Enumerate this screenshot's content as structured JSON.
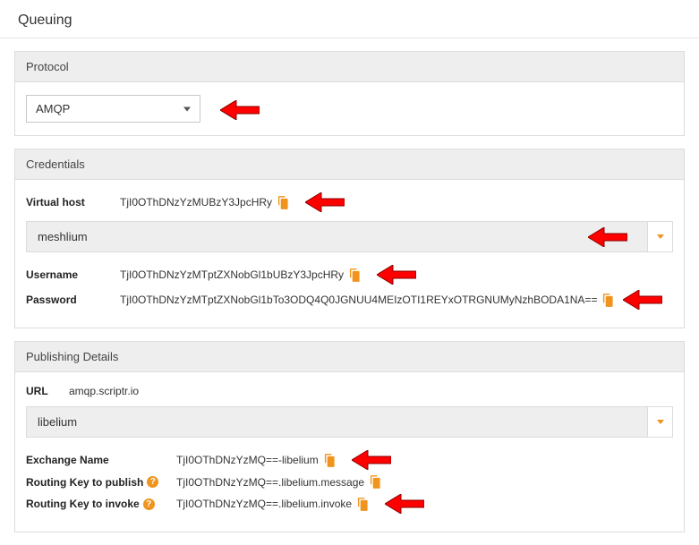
{
  "title": "Queuing",
  "protocol": {
    "header": "Protocol",
    "selected": "AMQP"
  },
  "credentials": {
    "header": "Credentials",
    "virtualHost": {
      "label": "Virtual host",
      "value": "TjI0OThDNzYzMUBzY3JpcHRy"
    },
    "dropdown": "meshlium",
    "username": {
      "label": "Username",
      "value": "TjI0OThDNzYzMTptZXNobGl1bUBzY3JpcHRy"
    },
    "password": {
      "label": "Password",
      "value": "TjI0OThDNzYzMTptZXNobGl1bTo3ODQ4Q0JGNUU4MEIzOTI1REYxOTRGNUMyNzhBODA1NA=="
    }
  },
  "publishing": {
    "header": "Publishing Details",
    "url": {
      "label": "URL",
      "value": "amqp.scriptr.io"
    },
    "dropdown": "libelium",
    "exchangeName": {
      "label": "Exchange Name",
      "value": "TjI0OThDNzYzMQ==-libelium"
    },
    "routingKeyPublish": {
      "label": "Routing Key to publish",
      "value": "TjI0OThDNzYzMQ==.libelium.message"
    },
    "routingKeyInvoke": {
      "label": "Routing Key to invoke",
      "value": "TjI0OThDNzYzMQ==.libelium.invoke"
    }
  }
}
